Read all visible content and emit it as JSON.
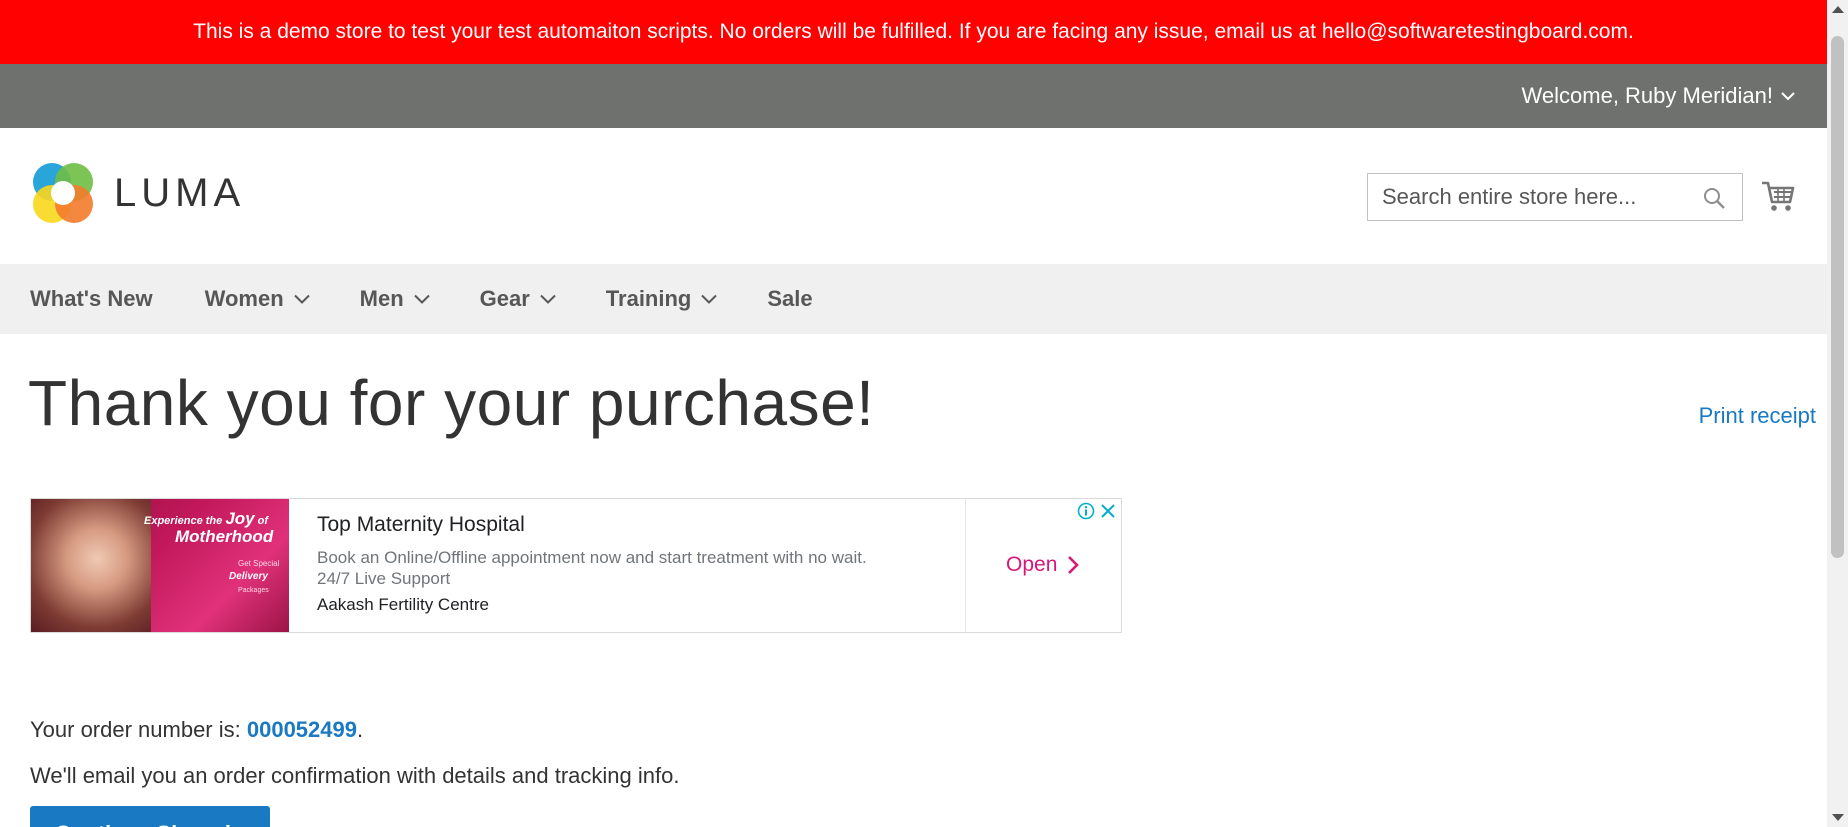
{
  "notice": {
    "text": "This is a demo store to test your test automaiton scripts. No orders will be fulfilled. If you are facing any issue, email us at hello@softwaretestingboard.com."
  },
  "header": {
    "welcome": "Welcome, Ruby Meridian!",
    "logo_text": "LUMA",
    "search_placeholder": "Search entire store here...",
    "search_value": ""
  },
  "nav": {
    "items": [
      {
        "label": "What's New",
        "has_menu": false
      },
      {
        "label": "Women",
        "has_menu": true
      },
      {
        "label": "Men",
        "has_menu": true
      },
      {
        "label": "Gear",
        "has_menu": true
      },
      {
        "label": "Training",
        "has_menu": true
      },
      {
        "label": "Sale",
        "has_menu": false
      }
    ]
  },
  "main": {
    "title": "Thank you for your purchase!",
    "print_receipt": "Print receipt",
    "order_prefix": "Your order number is: ",
    "order_number": "000052499",
    "order_suffix": ".",
    "email_text": "We'll email you an order confirmation with details and tracking info.",
    "continue_label": "Continue Shopping"
  },
  "ad": {
    "image": {
      "line1_a": "Experience the ",
      "line1_b": "Joy",
      "line1_c": " of",
      "line2": "Motherhood",
      "line3": "Get Special",
      "line4": "Delivery",
      "line5": "Packages"
    },
    "title": "Top Maternity Hospital",
    "desc_line1": "Book an Online/Offline appointment now and start treatment with no wait.",
    "desc_line2": "24/7 Live Support",
    "advertiser": "Aakash Fertility Centre",
    "cta": "Open"
  },
  "colors": {
    "notice_bg": "#ff0101",
    "panel_bg": "#6e716e",
    "nav_bg": "#f0f0f0",
    "link": "#1979c3",
    "ad_cta": "#d6187c"
  },
  "icons": {
    "search": "search-icon",
    "cart": "cart-icon",
    "chevron": "chevron-down-icon",
    "ad_info": "info-icon",
    "ad_close": "close-icon",
    "ad_arrow": "chevron-right-icon"
  }
}
